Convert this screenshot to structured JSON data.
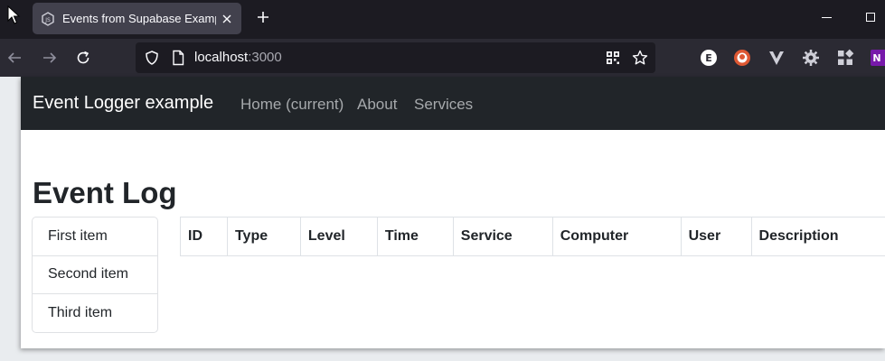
{
  "browser": {
    "tab_title": "Events from Supabase Example",
    "url_host": "localhost",
    "url_port": ":3000"
  },
  "app": {
    "brand": "Event Logger example",
    "nav": [
      "Home (current)",
      "About",
      "Services"
    ],
    "page_title": "Event Log",
    "list_items": [
      "First item",
      "Second item",
      "Third item"
    ],
    "table_headers": [
      "ID",
      "Type",
      "Level",
      "Time",
      "Service",
      "Computer",
      "User",
      "Description"
    ]
  },
  "colors": {
    "navbar_bg": "#212529",
    "nav_link": "#a6a9ac",
    "browser_tabbar": "#1c1b22",
    "browser_toolbar": "#2b2a33"
  }
}
